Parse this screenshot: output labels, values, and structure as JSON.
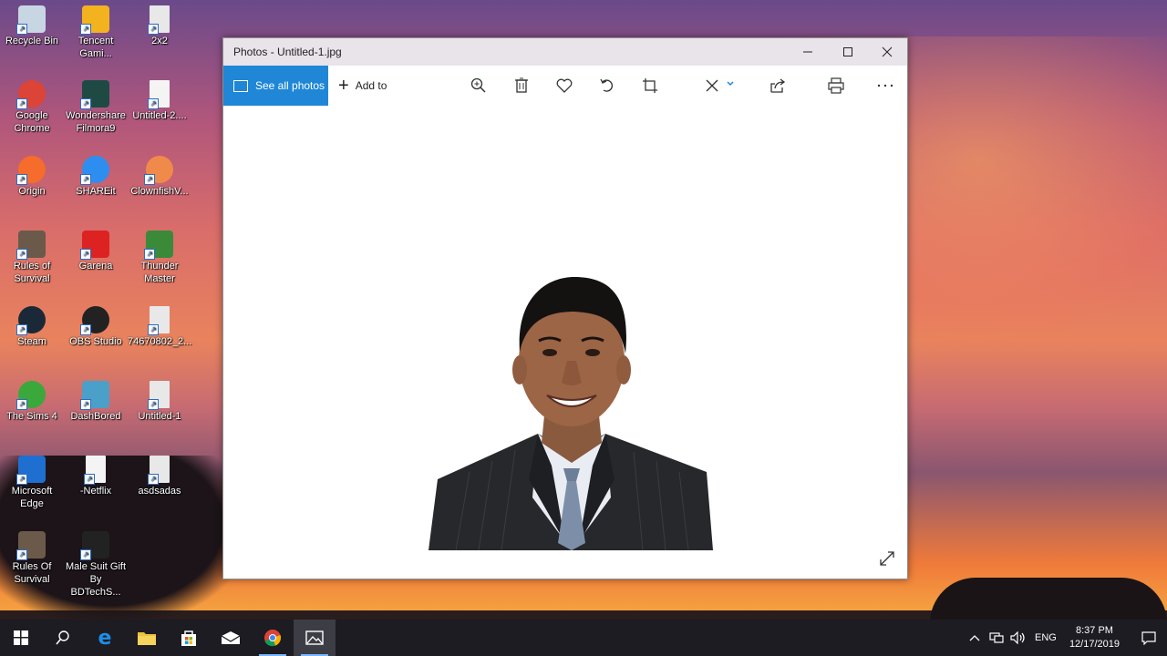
{
  "desktop": {
    "icons": [
      {
        "label": "Recycle Bin",
        "icon": "recycle-bin-icon",
        "color": "#c8d6e4"
      },
      {
        "label": "Tencent Gami...",
        "icon": "tencent-gaming-icon",
        "color": "#f3b31f"
      },
      {
        "label": "2x2",
        "icon": "photo-thumbnail-icon",
        "color": "#e8e8e8"
      },
      {
        "label": "Google Chrome",
        "icon": "chrome-icon",
        "color": "#db4437"
      },
      {
        "label": "Wondershare Filmora9",
        "icon": "filmora-icon",
        "color": "#1f4a44"
      },
      {
        "label": "Untitled-2....",
        "icon": "document-icon",
        "color": "#f4f4f4"
      },
      {
        "label": "Origin",
        "icon": "origin-icon",
        "color": "#f56c2d"
      },
      {
        "label": "SHAREit",
        "icon": "shareit-icon",
        "color": "#2e8ef0"
      },
      {
        "label": "ClownfishV...",
        "icon": "clownfish-icon",
        "color": "#f08a4a"
      },
      {
        "label": "Rules of Survival",
        "icon": "game-icon",
        "color": "#6b5a4a"
      },
      {
        "label": "Garena",
        "icon": "garena-icon",
        "color": "#d22"
      },
      {
        "label": "Thunder Master",
        "icon": "thunder-master-icon",
        "color": "#3a8a3a"
      },
      {
        "label": "Steam",
        "icon": "steam-icon",
        "color": "#1b2838"
      },
      {
        "label": "OBS Studio",
        "icon": "obs-icon",
        "color": "#222"
      },
      {
        "label": "74670802_2...",
        "icon": "photo-thumbnail-icon",
        "color": "#e8e8e8"
      },
      {
        "label": "The Sims 4",
        "icon": "sims-icon",
        "color": "#3aa83a"
      },
      {
        "label": "DashBored",
        "icon": "dashbored-icon",
        "color": "#4aa0c8"
      },
      {
        "label": "Untitled-1",
        "icon": "photo-thumbnail-icon",
        "color": "#e8e8e8"
      },
      {
        "label": "Microsoft Edge",
        "icon": "edge-icon",
        "color": "#1f6fd0"
      },
      {
        "label": "-Netflix",
        "icon": "document-icon",
        "color": "#f4f4f4"
      },
      {
        "label": "asdsadas",
        "icon": "photo-thumbnail-icon",
        "color": "#e8e8e8"
      },
      {
        "label": "Rules Of Survival",
        "icon": "game-icon",
        "color": "#6b5a4a"
      },
      {
        "label": "Male Suit Gift By BDTechS...",
        "icon": "suit-icon",
        "color": "#222"
      }
    ]
  },
  "window": {
    "title": "Photos - Untitled-1.jpg",
    "see_all": "See all photos",
    "add_to": "Add to",
    "accent": "#1f87d6"
  },
  "taskbar": {
    "time": "8:37 PM",
    "date": "12/17/2019",
    "lang": "ENG"
  }
}
